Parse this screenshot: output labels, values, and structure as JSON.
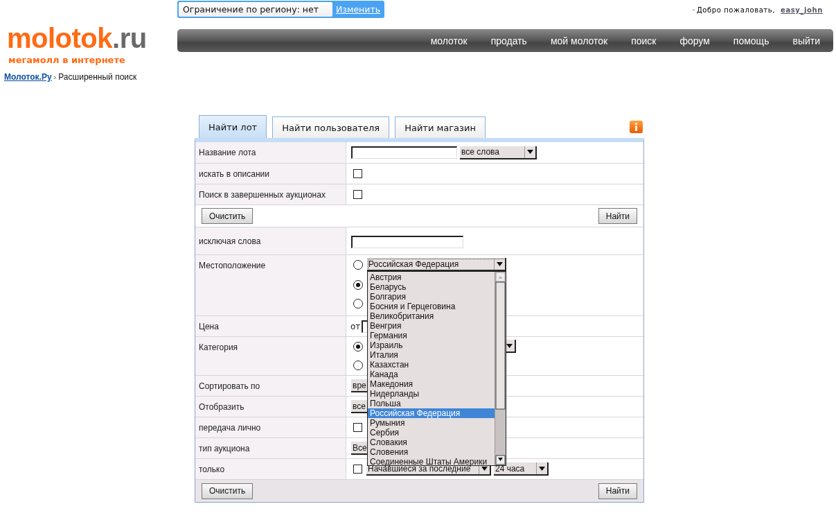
{
  "region_bar": {
    "label": "Ограничение по региону: нет",
    "link": "Изменить"
  },
  "welcome": {
    "text": "Добро пожаловать,",
    "user": "easy_john"
  },
  "logo": {
    "name": "molotok",
    "tld": ".ru",
    "tagline": "мегамолл в интернете"
  },
  "nav": [
    "молоток",
    "продать",
    "мой молоток",
    "поиск",
    "форум",
    "помощь",
    "выйти"
  ],
  "breadcrumb": {
    "home": "Молоток.Ру",
    "separator": "›",
    "current": "Расширенный поиск"
  },
  "tabs": [
    {
      "label": "Найти лот",
      "selected": true
    },
    {
      "label": "Найти пользователя",
      "selected": false
    },
    {
      "label": "Найти магазин",
      "selected": false
    }
  ],
  "form": {
    "sections": [
      {
        "rows": [
          {
            "label": "Название лота",
            "kind": "text_select",
            "select": "все слова"
          },
          {
            "label": "искать в описании",
            "kind": "checkbox",
            "checked": false
          },
          {
            "label": "Поиск в завершенных аукционах",
            "kind": "checkbox",
            "checked": false
          }
        ],
        "clear_button": "Очистить",
        "find_button": "Найти"
      },
      {
        "rows": [
          {
            "label": "исключая слова",
            "kind": "text"
          },
          {
            "label": "Местоположение",
            "kind": "radios",
            "options": [
              {
                "selected": false,
                "select": "Российская Федерация",
                "list": [
                  {
                    "label": "Австрия",
                    "selected": false
                  },
                  {
                    "label": "Беларусь",
                    "selected": false
                  },
                  {
                    "label": "Болгария",
                    "selected": false
                  },
                  {
                    "label": "Босния и Герцеговина",
                    "selected": false
                  },
                  {
                    "label": "Великобритания",
                    "selected": false
                  },
                  {
                    "label": "Венгрия",
                    "selected": false
                  },
                  {
                    "label": "Германия",
                    "selected": false
                  },
                  {
                    "label": "Израиль",
                    "selected": false
                  },
                  {
                    "label": "Италия",
                    "selected": false
                  },
                  {
                    "label": "Казахстан",
                    "selected": false
                  },
                  {
                    "label": "Канада",
                    "selected": false
                  },
                  {
                    "label": "Македония",
                    "selected": false
                  },
                  {
                    "label": "Нидерланды",
                    "selected": false
                  },
                  {
                    "label": "Польша",
                    "selected": false
                  },
                  {
                    "label": "Российская Федерация",
                    "selected": true
                  },
                  {
                    "label": "Румыния",
                    "selected": false
                  },
                  {
                    "label": "Сербия",
                    "selected": false
                  },
                  {
                    "label": "Словакия",
                    "selected": false
                  },
                  {
                    "label": "Словения",
                    "selected": false
                  },
                  {
                    "label": "Соединенные Штаты Америки",
                    "selected": false
                  }
                ]
              },
              {
                "selected": true
              },
              {
                "selected": false
              }
            ]
          },
          {
            "label": "Цена",
            "kind": "price",
            "from": "от"
          },
          {
            "label": "Категория",
            "kind": "radios",
            "options": [
              {
                "selected": true,
                "dropdown": true
              },
              {
                "selected": false
              }
            ]
          },
          {
            "label": "Сортировать по",
            "kind": "select",
            "select": "вре"
          },
          {
            "label": "Отобразить",
            "kind": "select",
            "select": "все"
          },
          {
            "label": "передача лично",
            "kind": "checkbox",
            "checked": false
          },
          {
            "label": "тип аукциона",
            "kind": "select",
            "select": "Все"
          },
          {
            "label": "только",
            "kind": "checkbox_selects",
            "checked": false,
            "selects": [
              "Начавшиеся за последние",
              "24 часа"
            ]
          }
        ],
        "clear_button": "Очистить",
        "find_button": "Найти"
      }
    ]
  }
}
